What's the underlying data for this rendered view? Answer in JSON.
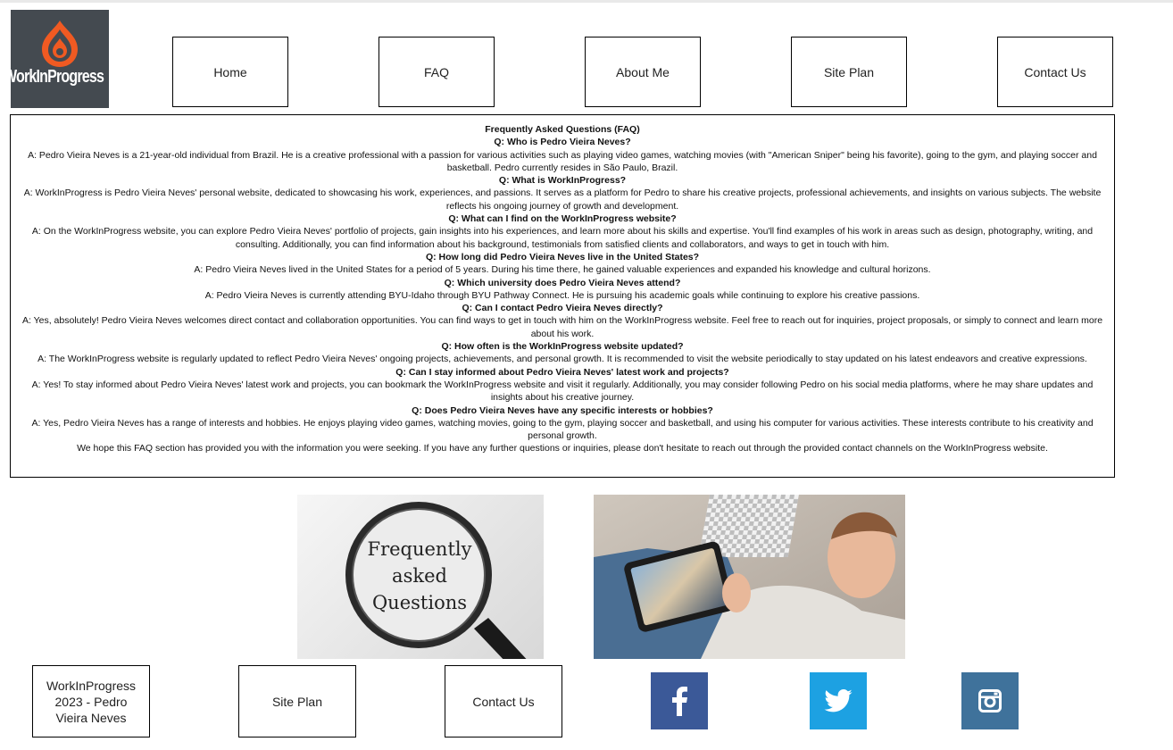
{
  "logo": {
    "text": "WorkInProgress"
  },
  "nav": {
    "items": [
      {
        "label": "Home"
      },
      {
        "label": "FAQ"
      },
      {
        "label": "About Me"
      },
      {
        "label": "Site Plan"
      },
      {
        "label": "Contact Us"
      }
    ]
  },
  "faq": {
    "title": "Frequently Asked Questions (FAQ)",
    "entries": [
      {
        "q": "Q: Who is Pedro Vieira Neves?",
        "a": "A: Pedro Vieira Neves is a 21-year-old individual from Brazil. He is a creative professional with a passion for various activities such as playing video games, watching movies (with \"American Sniper\" being his favorite), going to the gym, and playing soccer and basketball. Pedro currently resides in São Paulo, Brazil."
      },
      {
        "q": "Q: What is WorkInProgress?",
        "a": "A: WorkInProgress is Pedro Vieira Neves' personal website, dedicated to showcasing his work, experiences, and passions. It serves as a platform for Pedro to share his creative projects, professional achievements, and insights on various subjects. The website reflects his ongoing journey of growth and development."
      },
      {
        "q": "Q: What can I find on the WorkInProgress website?",
        "a": "A: On the WorkInProgress website, you can explore Pedro Vieira Neves' portfolio of projects, gain insights into his experiences, and learn more about his skills and expertise. You'll find examples of his work in areas such as design, photography, writing, and consulting. Additionally, you can find information about his background, testimonials from satisfied clients and collaborators, and ways to get in touch with him."
      },
      {
        "q": "Q: How long did Pedro Vieira Neves live in the United States?",
        "a": "A: Pedro Vieira Neves lived in the United States for a period of 5 years. During his time there, he gained valuable experiences and expanded his knowledge and cultural horizons."
      },
      {
        "q": "Q: Which university does Pedro Vieira Neves attend?",
        "a": "A: Pedro Vieira Neves is currently attending BYU-Idaho through BYU Pathway Connect. He is pursuing his academic goals while continuing to explore his creative passions."
      },
      {
        "q": "Q: Can I contact Pedro Vieira Neves directly?",
        "a": "A: Yes, absolutely! Pedro Vieira Neves welcomes direct contact and collaboration opportunities. You can find ways to get in touch with him on the WorkInProgress website. Feel free to reach out for inquiries, project proposals, or simply to connect and learn more about his work."
      },
      {
        "q": "Q: How often is the WorkInProgress website updated?",
        "a": "A: The WorkInProgress website is regularly updated to reflect Pedro Vieira Neves' ongoing projects, achievements, and personal growth. It is recommended to visit the website periodically to stay updated on his latest endeavors and creative expressions."
      },
      {
        "q": "Q: Can I stay informed about Pedro Vieira Neves' latest work and projects?",
        "a": "A: Yes! To stay informed about Pedro Vieira Neves' latest work and projects, you can bookmark the WorkInProgress website and visit it regularly. Additionally, you may consider following Pedro on his social media platforms, where he may share updates and insights about his creative journey."
      },
      {
        "q": "Q: Does Pedro Vieira Neves have any specific interests or hobbies?",
        "a": "A: Yes, Pedro Vieira Neves has a range of interests and hobbies. He enjoys playing video games, watching movies, going to the gym, playing soccer and basketball, and using his computer for various activities. These interests contribute to his creativity and personal growth."
      }
    ],
    "closing": "We hope this FAQ section has provided you with the information you were seeking. If you have any further questions or inquiries, please don't hesitate to reach out through the provided contact channels on the WorkInProgress website."
  },
  "images": {
    "faq_image_text": [
      "Frequently",
      "asked",
      "Questions"
    ]
  },
  "footer": {
    "copyright": "WorkInProgress 2023 - Pedro Vieira Neves",
    "site_plan": "Site Plan",
    "contact": "Contact Us",
    "social": [
      {
        "icon": "facebook-icon",
        "color": "#3b5998"
      },
      {
        "icon": "twitter-icon",
        "color": "#1da1e2"
      },
      {
        "icon": "instagram-icon",
        "color": "#3f729b"
      }
    ]
  }
}
